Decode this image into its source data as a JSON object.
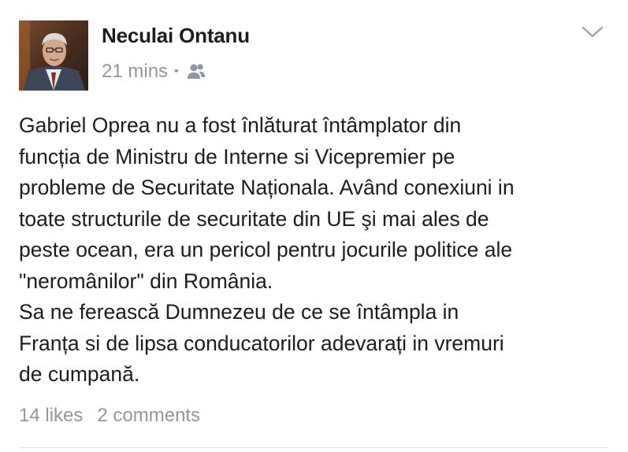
{
  "post": {
    "author": "Neculai Ontanu",
    "time": "21 mins",
    "separator": "•",
    "audience_icon": "friends-icon",
    "menu_icon": "chevron-down-icon",
    "body_lines": [
      "Gabriel Oprea nu a fost înlăturat întâmplator din",
      "funcția de Ministru de Interne si Vicepremier pe",
      "probleme de Securitate Naționala. Având conexiuni in",
      "toate structurile de securitate din UE şi mai ales de",
      "peste ocean, era un pericol pentru jocurile politice ale",
      "\"neromânilor\" din România.",
      "Sa ne ferească Dumnezeu de ce se întâmpla in",
      "Franța si de lipsa conducatorilor adevarați in vremuri",
      "de cumpană."
    ],
    "likes": "14 likes",
    "comments": "2 comments"
  },
  "colors": {
    "text": "#1d1d1f",
    "meta": "#9197a3",
    "divider": "#e1e2e6"
  }
}
